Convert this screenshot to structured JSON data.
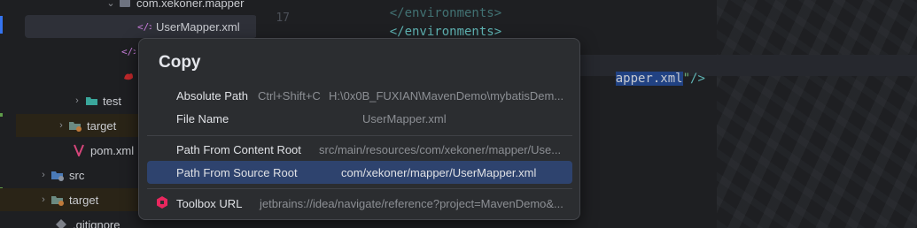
{
  "tree": {
    "rows": [
      {
        "label": "com.xekoner.mapper",
        "icon": "package-icon"
      },
      {
        "label": "UserMapper.xml",
        "icon": "xml-file-icon"
      },
      {
        "label": "",
        "icon": "xml-file-icon"
      },
      {
        "label": "",
        "icon": "mybatis-icon"
      },
      {
        "label": "test",
        "icon": "folder-icon"
      },
      {
        "label": "target",
        "icon": "excluded-folder-icon"
      },
      {
        "label": "pom.xml",
        "icon": "maven-icon"
      },
      {
        "label": "src",
        "icon": "source-folder-icon"
      },
      {
        "label": "target",
        "icon": "excluded-folder-icon"
      },
      {
        "label": ".gitignore",
        "icon": "gitignore-icon"
      }
    ]
  },
  "editor": {
    "lines": [
      {
        "number": "",
        "text": "</environments>"
      },
      {
        "number": "17",
        "text": "</environments>"
      }
    ],
    "closing_tag": "</environments>",
    "selected_fragment": "apper.xml",
    "tail_quote": "\"",
    "tail_close": "/>"
  },
  "popup": {
    "title": "Copy",
    "items": [
      {
        "label": "Absolute Path",
        "shortcut": "Ctrl+Shift+C",
        "value": "H:\\0x0B_FUXIAN\\MavenDemo\\mybatisDem...",
        "active": false
      },
      {
        "label": "File Name",
        "shortcut": "",
        "value": "UserMapper.xml",
        "active": false
      },
      {
        "label": "Path From Content Root",
        "shortcut": "",
        "value": "src/main/resources/com/xekoner/mapper/Use...",
        "active": false
      },
      {
        "label": "Path From Source Root",
        "shortcut": "",
        "value": "com/xekoner/mapper/UserMapper.xml",
        "active": true
      },
      {
        "label": "Toolbox URL",
        "shortcut": "",
        "value": "jetbrains://idea/navigate/reference?project=MavenDemo&...",
        "active": false,
        "icon": "toolbox-icon"
      }
    ]
  },
  "colors": {
    "background": "#1e1f22",
    "popup_bg": "#2b2d30",
    "active_item": "#2e436e",
    "xml_tag": "#5fb4b4",
    "selection": "#214283"
  }
}
